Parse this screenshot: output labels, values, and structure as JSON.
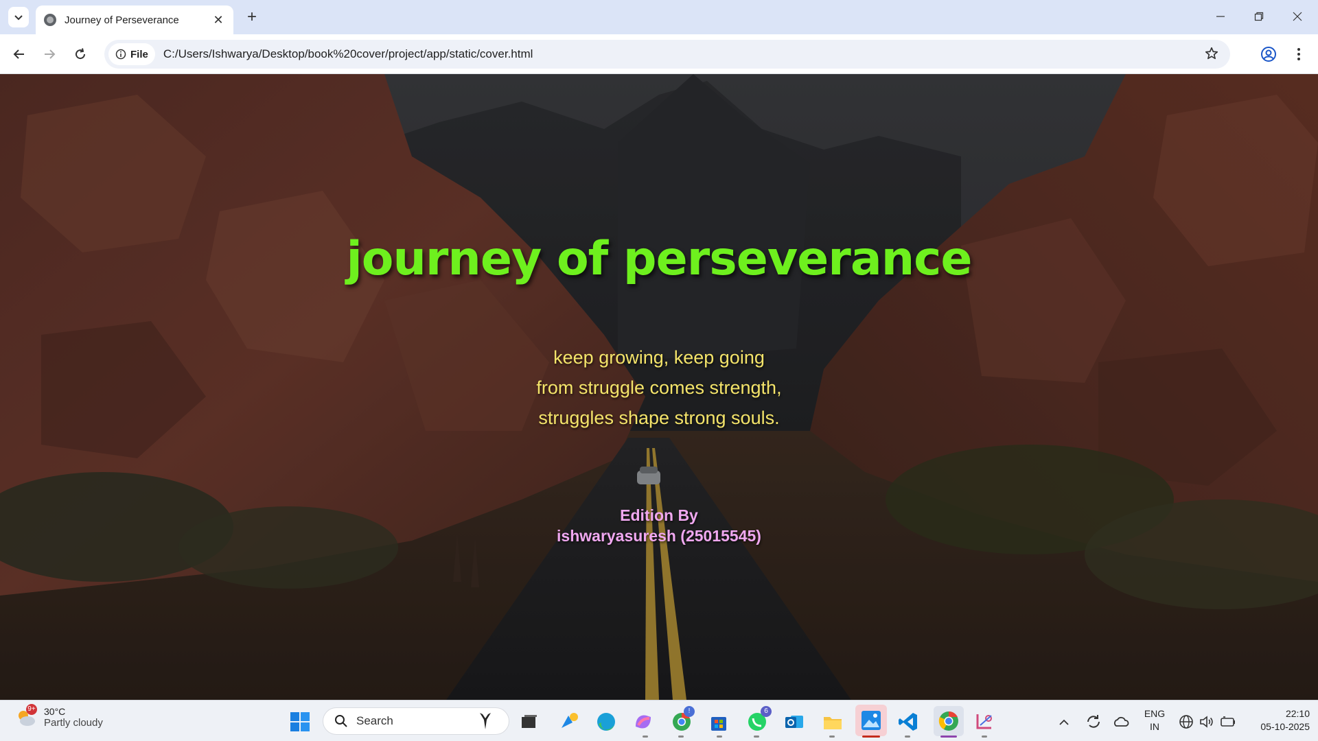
{
  "browser": {
    "tab_title": "Journey of Perseverance",
    "chip_label": "File",
    "url": "C:/Users/Ishwarya/Desktop/book%20cover/project/app/static/cover.html"
  },
  "cover": {
    "title": "journey of perseverance",
    "quote_lines": [
      "keep growing, keep going",
      "from struggle comes strength,",
      "struggles shape strong souls."
    ],
    "edition_label": "Edition By",
    "author": "ishwaryasuresh (25015545)",
    "colors": {
      "title": "#6ef01e",
      "quote": "#f4e46a",
      "edition": "#f0a8f0"
    }
  },
  "taskbar": {
    "weather": {
      "temp": "30°C",
      "desc": "Partly cloudy",
      "badge": "9+"
    },
    "search_label": "Search",
    "whatsapp_badge": "6",
    "chrome_badge": "!",
    "language": {
      "line1": "ENG",
      "line2": "IN"
    },
    "clock": {
      "time": "22:10",
      "date": "05-10-2025"
    }
  }
}
